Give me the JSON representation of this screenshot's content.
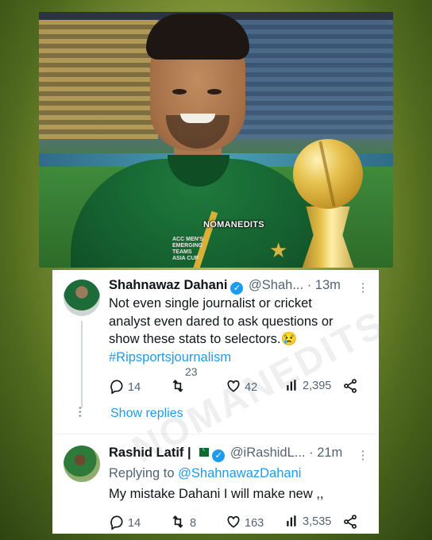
{
  "photo": {
    "watermark": "NOMANEDITS",
    "crest_text": [
      "ACC MEN'S",
      "EMERGING TEAMS",
      "ASIA CUP"
    ]
  },
  "overlay_watermark": "NOMANEDITS",
  "tweets": [
    {
      "name": "Shahnawaz Dahani",
      "handle": "@Shah...",
      "time": "· 13m",
      "text_line1": "Not even single journalist or cricket",
      "text_line2": "analyst even dared to ask questions or",
      "text_line3": "show these stats to selectors.",
      "emoji": "😢",
      "hashtag": "#Ripsportsjournalism",
      "replies": "14",
      "retweets": "23",
      "likes": "42",
      "views": "2,395",
      "show_replies": "Show replies"
    },
    {
      "name": "Rashid Latif |",
      "handle": "@iRashidL...",
      "time": "· 21m",
      "replying_prefix": "Replying to ",
      "replying_to": "@ShahnawazDahani",
      "text": "My mistake Dahani I will make new ,,",
      "replies": "14",
      "retweets": "8",
      "likes": "163",
      "views": "3,535"
    }
  ],
  "colors": {
    "link": "#1d9bf0",
    "text": "#0f1419",
    "muted": "#536471",
    "jersey": "#15602f"
  },
  "icons": [
    "reply-icon",
    "retweet-icon",
    "like-icon",
    "views-icon",
    "share-icon",
    "verified-icon",
    "more-icon",
    "pakistan-flag-icon"
  ]
}
